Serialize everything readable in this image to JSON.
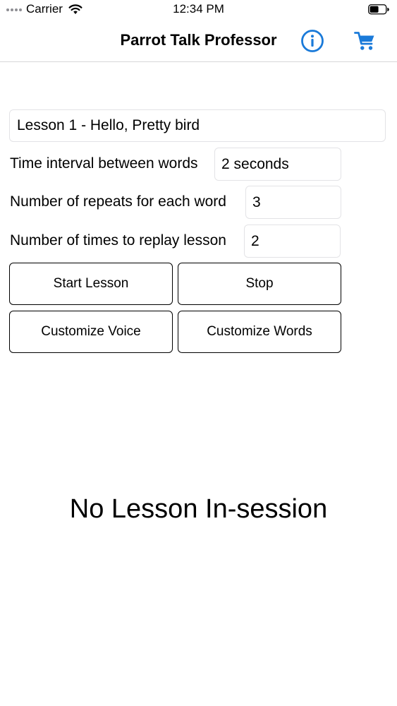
{
  "status_bar": {
    "carrier": "Carrier",
    "time": "12:34 PM",
    "icons": [
      "signal-dots-icon",
      "wifi-icon",
      "battery-icon"
    ]
  },
  "nav": {
    "title": "Parrot Talk Professor",
    "info_icon": "info-circle-icon",
    "cart_icon": "shopping-cart-icon",
    "accent_color": "#1a7ad9"
  },
  "lesson": {
    "selected": "Lesson 1 - Hello, Pretty bird"
  },
  "settings": {
    "interval_label": "Time interval between words",
    "interval_value": "2 seconds",
    "repeats_label": "Number of repeats for each word",
    "repeats_value": "3",
    "replay_label": "Number of times to replay lesson",
    "replay_value": "2"
  },
  "buttons": {
    "start": "Start Lesson",
    "stop": "Stop",
    "customize_voice": "Customize Voice",
    "customize_words": "Customize Words"
  },
  "session": {
    "status": "No Lesson In-session"
  }
}
